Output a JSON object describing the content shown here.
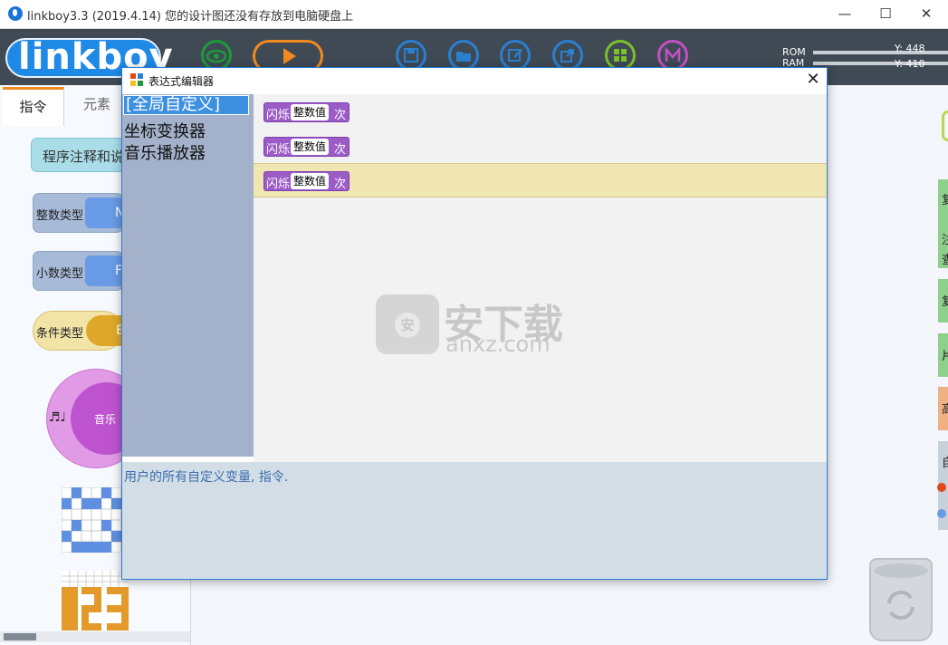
{
  "window": {
    "title": "linkboy3.3 (2019.4.14) 您的设计图还没有存放到电脑硬盘上",
    "minimize": "—",
    "maximize": "☐",
    "close": "✕"
  },
  "toolbar": {
    "logo": "linkboy",
    "rom_label": "ROM",
    "ram_label": "RAM",
    "y_readout_1": "Y: 448",
    "y_readout_2": "Y: 410",
    "icons": [
      "eye-icon",
      "play-icon",
      "save-icon",
      "open-folder-icon",
      "edit-icon",
      "export-icon",
      "grid-icon",
      "m-logo-icon"
    ],
    "colors": {
      "eye": "#1d9b3a",
      "play": "#f08a1e",
      "blue": "#2b7fd1",
      "grid": "#7bbf2a",
      "m": "#c64fc8"
    }
  },
  "left_panel": {
    "tabs": [
      "指令",
      "元素"
    ],
    "comment_block": "程序注释和说",
    "blocks": [
      {
        "label": "整数类型",
        "chip": "N"
      },
      {
        "label": "小数类型",
        "chip": "F"
      },
      {
        "label": "条件类型",
        "chip": "B"
      }
    ],
    "music": {
      "left": "♬♩",
      "center": "音乐"
    }
  },
  "dialog": {
    "title": "表达式编辑器",
    "close": "✕",
    "categories": [
      "[全局自定义]",
      "坐标变换器",
      "音乐播放器"
    ],
    "rows": [
      {
        "prefix": "闪烁",
        "value": "整数值",
        "suffix": "次"
      },
      {
        "prefix": "闪烁",
        "value": "整数值",
        "suffix": "次"
      },
      {
        "prefix": "闪烁",
        "value": "整数值",
        "suffix": "次"
      }
    ],
    "description": "用户的所有自定义变量, 指令."
  },
  "watermark": {
    "main": "安下载",
    "sub": "anxz.com",
    "badge": "安"
  },
  "right_strip": [
    "复",
    "注",
    "查",
    "复",
    "片",
    "高",
    "自"
  ]
}
